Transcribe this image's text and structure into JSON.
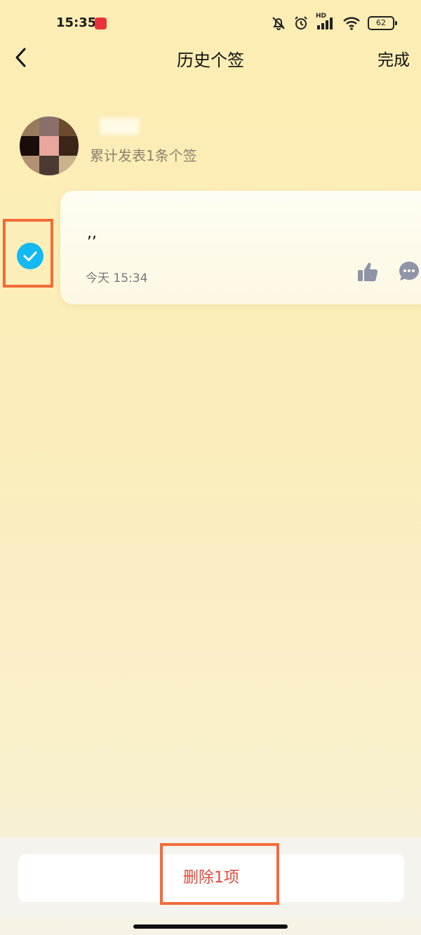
{
  "status_bar": {
    "time": "15:35",
    "network_label": "HD",
    "battery": "62",
    "icons": [
      "app-badge-icon",
      "mute-bell-icon",
      "alarm-icon",
      "signal-icon",
      "wifi-icon",
      "battery-icon"
    ]
  },
  "header": {
    "back_icon": "chevron-left-icon",
    "title": "历史个签",
    "done_label": "完成"
  },
  "profile": {
    "avatar": "avatar (pixelated)",
    "summary": "累计发表1条个签"
  },
  "signatures": [
    {
      "text": ",,",
      "time": "今天 15:34",
      "selected": true,
      "actions": [
        "thumb-up-icon",
        "comment-icon"
      ]
    }
  ],
  "footer": {
    "delete_label": "删除1项"
  },
  "colors": {
    "accent_check": "#12b9f2",
    "highlight_border": "#f26b3a",
    "delete_text": "#e04a3a"
  }
}
